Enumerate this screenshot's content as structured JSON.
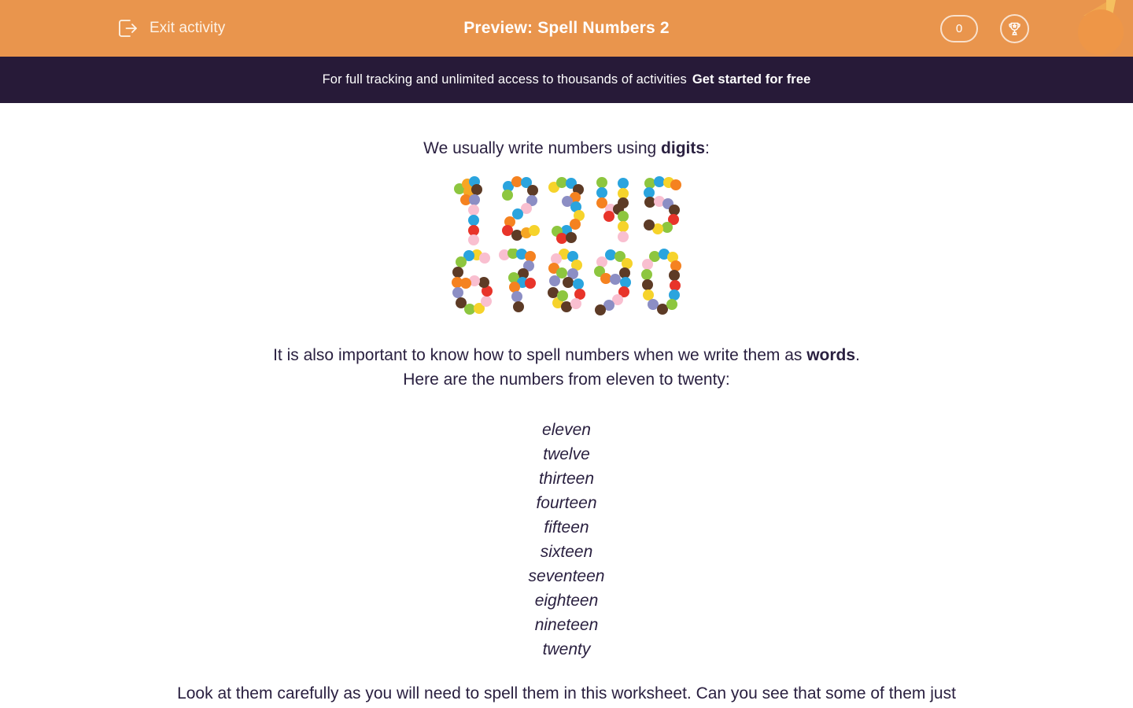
{
  "topbar": {
    "exit_label": "Exit activity",
    "exit_icon": "logout-icon",
    "title": "Preview: Spell Numbers 2",
    "coin_count": "0",
    "trophy_icon": "trophy-icon",
    "logo": "orange-fruit-logo",
    "bg_color": "#e9954d",
    "text_color": "#ffffff"
  },
  "promo": {
    "message": "For full tracking and unlimited access to thousands of activities",
    "cta": "Get started for free",
    "bg_color": "#271a38"
  },
  "worksheet": {
    "intro_prefix": "We usually write numbers using ",
    "intro_bold": "digits",
    "intro_suffix": ":",
    "figure": {
      "alt": "candy-digits-image",
      "digits": [
        "1",
        "2",
        "3",
        "4",
        "5",
        "6",
        "7",
        "8",
        "9",
        "0"
      ]
    },
    "para_line1_prefix": "It is also important to know how to spell numbers when we write them as ",
    "para_line1_bold": "words",
    "para_line1_suffix": ".",
    "para_line2": "Here are the numbers from eleven to twenty:",
    "words": [
      "eleven",
      "twelve",
      "thirteen",
      "fourteen",
      "fifteen",
      "sixteen",
      "seventeen",
      "eighteen",
      "nineteen",
      "twenty"
    ],
    "closing": "Look at them carefully as you will need to spell them in this worksheet. Can you see that some of them just",
    "text_color": "#2a2040"
  }
}
